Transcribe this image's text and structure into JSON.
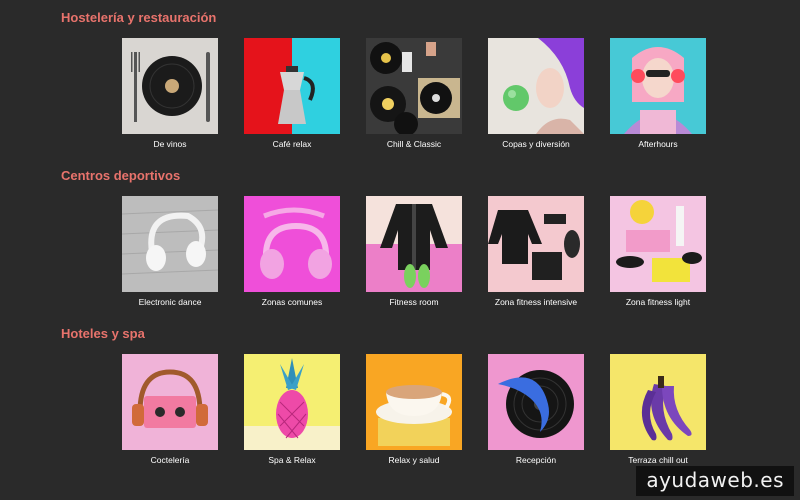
{
  "sections": [
    {
      "title": "Hostelería y restauración",
      "items": [
        {
          "label": "De vinos"
        },
        {
          "label": "Café relax"
        },
        {
          "label": "Chill & Classic"
        },
        {
          "label": "Copas y diversión"
        },
        {
          "label": "Afterhours"
        }
      ]
    },
    {
      "title": "Centros deportivos",
      "items": [
        {
          "label": "Electronic dance"
        },
        {
          "label": "Zonas comunes"
        },
        {
          "label": "Fitness room"
        },
        {
          "label": "Zona fitness intensive"
        },
        {
          "label": "Zona fitness light"
        }
      ]
    },
    {
      "title": "Hoteles y spa",
      "items": [
        {
          "label": "Coctelería"
        },
        {
          "label": "Spa & Relax"
        },
        {
          "label": "Relax y salud"
        },
        {
          "label": "Recepción"
        },
        {
          "label": "Terraza chill out"
        }
      ]
    }
  ],
  "watermark": "ayudaweb.es",
  "colors": {
    "background": "#2a2a2a",
    "section_title": "#e8736c",
    "label": "#ffffff"
  }
}
